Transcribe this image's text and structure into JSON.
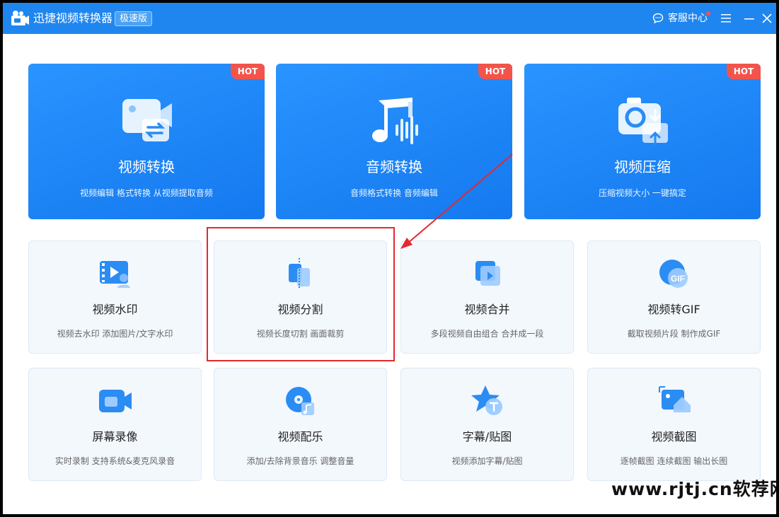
{
  "app": {
    "title": "迅捷视频转换器",
    "edition": "极速版",
    "service_label": "客服中心"
  },
  "colors": {
    "titlebar": "#1f86ef",
    "big_card": "#1a83f3",
    "hot": "#f2544b",
    "tool_card_bg": "#f3f8fd",
    "highlight": "#e3292f"
  },
  "big_cards": [
    {
      "title": "视频转换",
      "subtitle": "视频编辑 格式转换 从视频提取音频",
      "badge": "HOT",
      "icon": "video-convert-icon"
    },
    {
      "title": "音频转换",
      "subtitle": "音频格式转换 音频编辑",
      "badge": "HOT",
      "icon": "audio-convert-icon"
    },
    {
      "title": "视频压缩",
      "subtitle": "压缩视频大小 一键搞定",
      "badge": "HOT",
      "icon": "video-compress-icon"
    }
  ],
  "tools": [
    {
      "title": "视频水印",
      "subtitle": "视频去水印 添加图片/文字水印",
      "icon": "watermark-icon"
    },
    {
      "title": "视频分割",
      "subtitle": "视频长度切割 画面裁剪",
      "icon": "split-icon"
    },
    {
      "title": "视频合并",
      "subtitle": "多段视频自由组合 合并成一段",
      "icon": "merge-icon"
    },
    {
      "title": "视频转GIF",
      "subtitle": "截取视频片段 制作成GIF",
      "icon": "gif-icon"
    },
    {
      "title": "屏幕录像",
      "subtitle": "实时录制 支持系统&麦克风录音",
      "icon": "screen-record-icon"
    },
    {
      "title": "视频配乐",
      "subtitle": "添加/去除背景音乐 调整音量",
      "icon": "music-icon"
    },
    {
      "title": "字幕/贴图",
      "subtitle": "视频添加字幕/贴图",
      "icon": "subtitle-icon"
    },
    {
      "title": "视频截图",
      "subtitle": "逐帧截图 连续截图 输出长图",
      "icon": "screenshot-icon"
    }
  ],
  "watermark": "www.rjtj.cn软荐网"
}
